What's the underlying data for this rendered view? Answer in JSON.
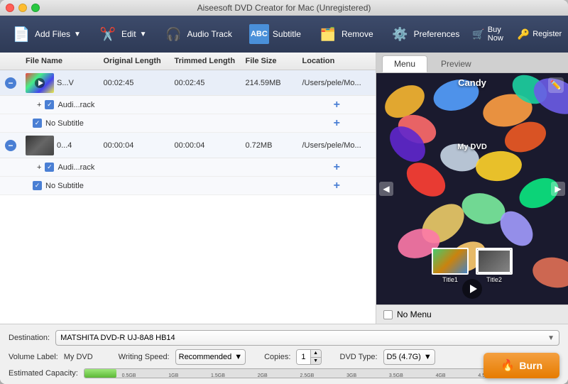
{
  "window": {
    "title": "Aiseesoft DVD Creator for Mac (Unregistered)"
  },
  "toolbar": {
    "add_files": "Add Files",
    "edit": "Edit",
    "audio_track": "Audio Track",
    "subtitle": "Subtitle",
    "remove": "Remove",
    "preferences": "Preferences",
    "buy_now": "Buy Now",
    "register": "Register"
  },
  "file_list": {
    "headers": [
      "",
      "File Name",
      "Original Length",
      "Trimmed Length",
      "File Size",
      "Location"
    ],
    "rows": [
      {
        "id": 1,
        "name": "S...V",
        "original": "00:02:45",
        "trimmed": "00:02:45",
        "size": "214.59MB",
        "location": "/Users/pele/Mo...",
        "audio": "Audi...rack",
        "subtitle": "No Subtitle"
      },
      {
        "id": 2,
        "name": "0...4",
        "original": "00:00:04",
        "trimmed": "00:00:04",
        "size": "0.72MB",
        "location": "/Users/pele/Mo...",
        "audio": "Audi...rack",
        "subtitle": "No Subtitle"
      }
    ]
  },
  "preview": {
    "tab_menu": "Menu",
    "tab_preview": "Preview",
    "title": "Candy",
    "dvd_label": "My DVD",
    "thumb1_label": "Title1",
    "thumb2_label": "Title2",
    "no_menu_label": "No Menu"
  },
  "bottom": {
    "destination_label": "Destination:",
    "destination_value": "MATSHITA DVD-R  UJ-8A8 HB14",
    "volume_label": "Volume Label:",
    "volume_value": "My DVD",
    "writing_speed_label": "Writing Speed:",
    "writing_speed_value": "Recommended",
    "copies_label": "Copies:",
    "copies_value": "1",
    "dvd_type_label": "DVD Type:",
    "dvd_type_value": "D5 (4.7G)",
    "capacity_label": "Estimated Capacity:",
    "burn_label": "Burn",
    "progress_marks": [
      "0.5GB",
      "1GB",
      "1.5GB",
      "2GB",
      "2.5GB",
      "3GB",
      "3.5GB",
      "4GB",
      "4.5GB"
    ]
  }
}
